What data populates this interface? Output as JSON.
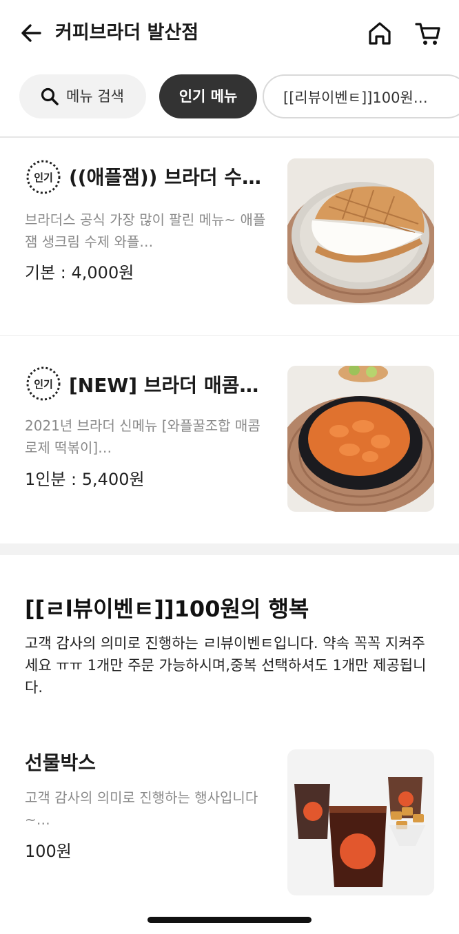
{
  "header": {
    "title": "커피브라더 발산점",
    "icons": {
      "back": "arrow-left-icon",
      "home": "home-icon",
      "cart": "cart-icon"
    }
  },
  "chips": {
    "search_label": "메뉴 검색",
    "popular_label": "인기 메뉴",
    "review_label": "[[리뷰이벤ㅌ]]100원…"
  },
  "items": [
    {
      "badge": "인기",
      "name": "((애플잼)) 브라더 수…",
      "desc": "브라더스 공식 가장 많이 팔린 메뉴~ 애플잼 생크림 수제 와플…",
      "price": "기본 : 4,000원"
    },
    {
      "badge": "인기",
      "name": "[NEW] 브라더 매콤…",
      "desc": "2021년 브라더 신메뉴 [와플꿀조합 매콤 로제 떡볶이]…",
      "price": "1인분 : 5,400원"
    }
  ],
  "section": {
    "title": "[[ㄹl뷰이벤ㅌ]]100원의 행복",
    "desc": "고객 감사의 의미로 진행하는 ㄹl뷰이벤ㅌ입니다. 약속 꼭꼭 지켜주세요 ㅠㅠ 1개만 주문 가능하시며,중복 선택하셔도 1개만 제공됩니다.",
    "item": {
      "name": "선물박스",
      "desc": "고객 감사의 의미로 진행하는 행사입니다~…",
      "price": "100원"
    }
  },
  "colors": {
    "chip_active_bg": "#333333",
    "chip_inactive_bg": "#f2f2f2",
    "divider": "#ececec",
    "muted_text": "#8a8a8a"
  }
}
